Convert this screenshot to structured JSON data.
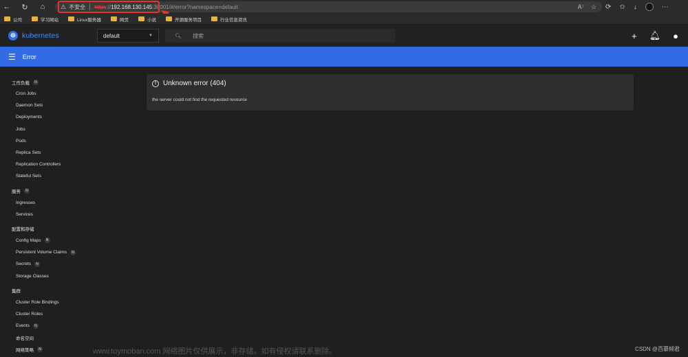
{
  "browser": {
    "security_warning": "不安全",
    "url_scheme": "https",
    "url_host": "192.168.130.145",
    "url_port": ":30001",
    "url_path": "/#/error?namespace=default",
    "read_aloud": "A⁷",
    "buttons": [
      "back",
      "refresh",
      "home",
      "extensions",
      "favorites",
      "downloads",
      "profile",
      "more"
    ]
  },
  "bookmarks": [
    {
      "label": "公司"
    },
    {
      "label": "学习网站"
    },
    {
      "label": "Linux服务器"
    },
    {
      "label": "网页"
    },
    {
      "label": "小说"
    },
    {
      "label": "开源服务项目"
    },
    {
      "label": "行业信息资讯"
    }
  ],
  "header": {
    "logo_text": "kubernetes",
    "namespace": "default",
    "search_placeholder": "搜索"
  },
  "topbar": {
    "title": "Error"
  },
  "sidebar": {
    "sections": [
      {
        "title": "工作负载",
        "badge": "N",
        "items": [
          {
            "label": "Cron Jobs"
          },
          {
            "label": "Daemon Sets"
          },
          {
            "label": "Deployments"
          },
          {
            "label": "Jobs"
          },
          {
            "label": "Pods"
          },
          {
            "label": "Replica Sets"
          },
          {
            "label": "Replication Controllers"
          },
          {
            "label": "Stateful Sets"
          }
        ]
      },
      {
        "title": "服务",
        "badge": "N",
        "items": [
          {
            "label": "Ingresses"
          },
          {
            "label": "Services"
          }
        ]
      },
      {
        "title": "配置和存储",
        "badge": "",
        "items": [
          {
            "label": "Config Maps",
            "badge": "N"
          },
          {
            "label": "Persistent Volume Claims",
            "badge": "N"
          },
          {
            "label": "Secrets",
            "badge": "N"
          },
          {
            "label": "Storage Classes"
          }
        ]
      },
      {
        "title": "集群",
        "badge": "",
        "items": [
          {
            "label": "Cluster Role Bindings"
          },
          {
            "label": "Cluster Roles"
          },
          {
            "label": "Events",
            "badge": "N"
          },
          {
            "label": "命名空间"
          },
          {
            "label": "网络策略",
            "badge": "N"
          }
        ]
      }
    ]
  },
  "error": {
    "title": "Unknown error (404)",
    "message": "the server could not find the requested resource"
  },
  "footer": {
    "watermark": "www.toymoban.com 网络图片仅供展示，非存储，如有侵权请联系删除。",
    "credit": "CSDN @百慕倾君"
  },
  "colors": {
    "accent": "#326ce5",
    "annotation": "#e8322b",
    "background": "#1f1f1f",
    "card": "#2e2e2e"
  }
}
